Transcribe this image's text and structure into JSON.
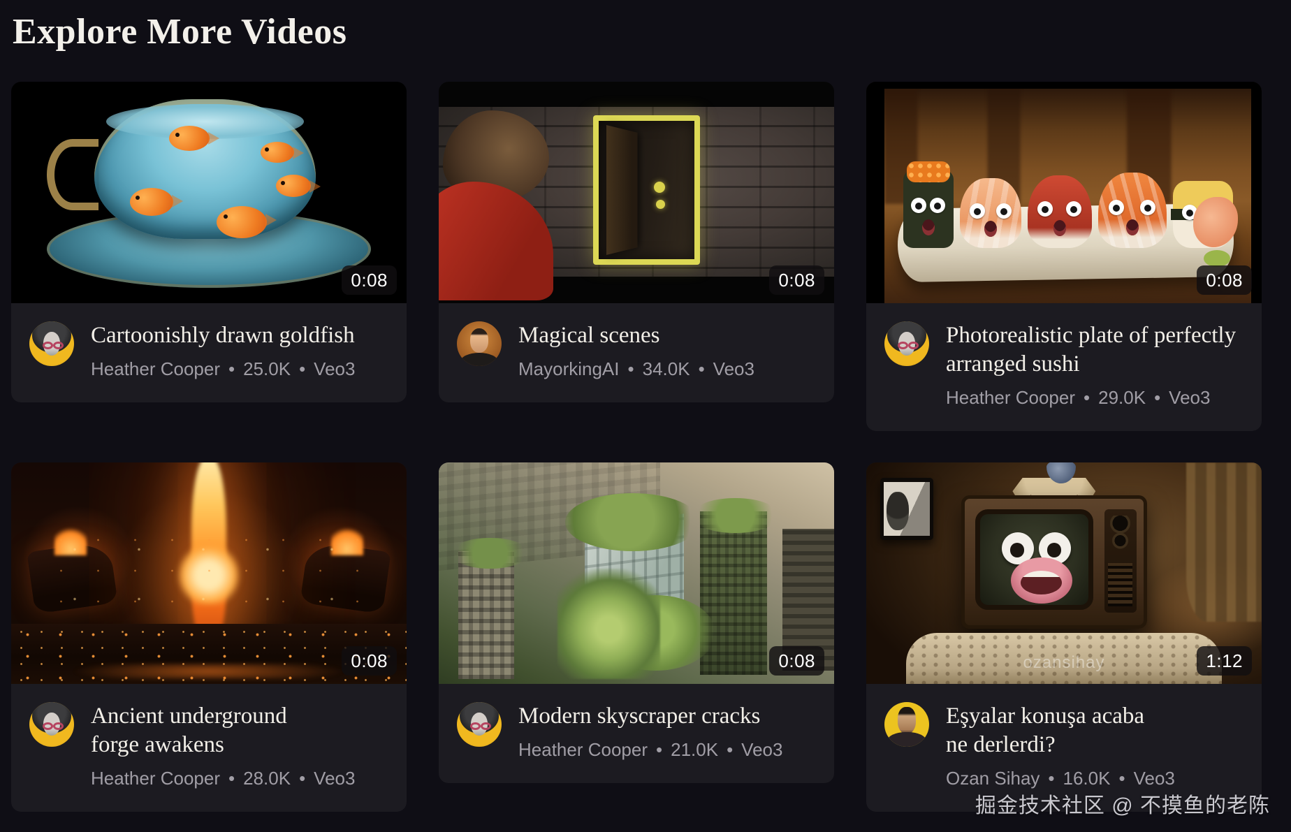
{
  "page": {
    "title": "Explore More Videos",
    "watermark": "掘金技术社区 @ 不摸鱼的老陈",
    "meta_separator": "•",
    "colors": {
      "page_background": "#0f0e15",
      "card_background": "#1c1b21",
      "title_text": "#f2efe8",
      "muted_text": "#a19ea6",
      "badge_background": "#100e10"
    }
  },
  "cards": [
    {
      "title": "Cartoonishly drawn goldfish",
      "author": "Heather Cooper",
      "views": "25.0K",
      "model": "Veo3",
      "duration": "0:08",
      "thumbnail": "goldfish-in-glass-teacup"
    },
    {
      "title": "Magical scenes",
      "author": "MayorkingAI",
      "views": "34.0K",
      "model": "Veo3",
      "duration": "0:08",
      "thumbnail": "boy-at-chalk-drawn-door"
    },
    {
      "title": "Photorealistic plate of perfectly arranged sushi",
      "author": "Heather Cooper",
      "views": "29.0K",
      "model": "Veo3",
      "duration": "0:08",
      "thumbnail": "sushi-with-cartoon-faces"
    },
    {
      "title": "Ancient underground forge awakens",
      "author": "Heather Cooper",
      "views": "28.0K",
      "model": "Veo3",
      "duration": "0:08",
      "thumbnail": "underground-lava-forge"
    },
    {
      "title": "Modern skyscraper cracks",
      "author": "Heather Cooper",
      "views": "21.0K",
      "model": "Veo3",
      "duration": "0:08",
      "thumbnail": "overgrown-green-skyscrapers"
    },
    {
      "title": "Eşyalar konuşa acaba ne derlerdi?",
      "author": "Ozan Sihay",
      "views": "16.0K",
      "model": "Veo3",
      "duration": "1:12",
      "thumbnail": "vintage-tv-with-googly-eyes",
      "video_watermark": "ozansihay"
    }
  ]
}
